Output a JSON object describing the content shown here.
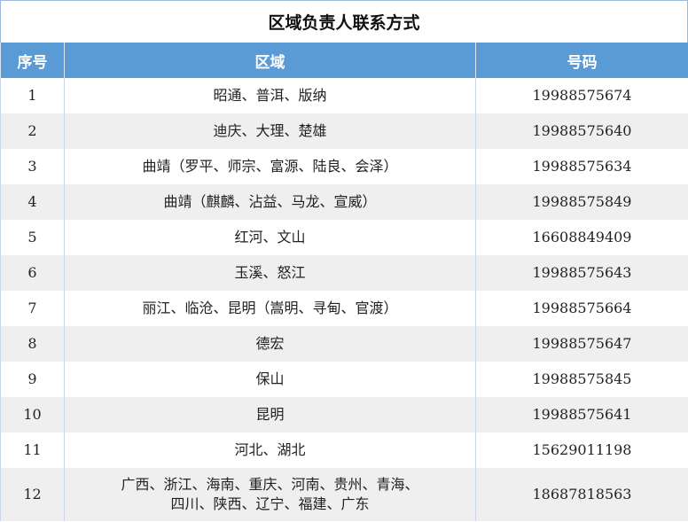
{
  "title": "区域负责人联系方式",
  "headers": {
    "seq": "序号",
    "region": "区域",
    "phone": "号码"
  },
  "rows": [
    {
      "seq": "1",
      "region": "昭通、普洱、版纳",
      "phone": "19988575674"
    },
    {
      "seq": "2",
      "region": "迪庆、大理、楚雄",
      "phone": "19988575640"
    },
    {
      "seq": "3",
      "region": "曲靖（罗平、师宗、富源、陆良、会泽）",
      "phone": "19988575634"
    },
    {
      "seq": "4",
      "region": "曲靖（麒麟、沾益、马龙、宣威）",
      "phone": "19988575849"
    },
    {
      "seq": "5",
      "region": "红河、文山",
      "phone": "16608849409"
    },
    {
      "seq": "6",
      "region": "玉溪、怒江",
      "phone": "19988575643"
    },
    {
      "seq": "7",
      "region": "丽江、临沧、昆明（嵩明、寻甸、官渡）",
      "phone": "19988575664"
    },
    {
      "seq": "8",
      "region": "德宏",
      "phone": "19988575647"
    },
    {
      "seq": "9",
      "region": "保山",
      "phone": "19988575845"
    },
    {
      "seq": "10",
      "region": "昆明",
      "phone": "19988575641"
    },
    {
      "seq": "11",
      "region": "河北、湖北",
      "phone": "15629011198"
    },
    {
      "seq": "12",
      "region_line1": "广西、浙江、海南、重庆、河南、贵州、青海、",
      "region_line2": "四川、陕西、辽宁、福建、广东",
      "phone": "18687818563"
    }
  ]
}
